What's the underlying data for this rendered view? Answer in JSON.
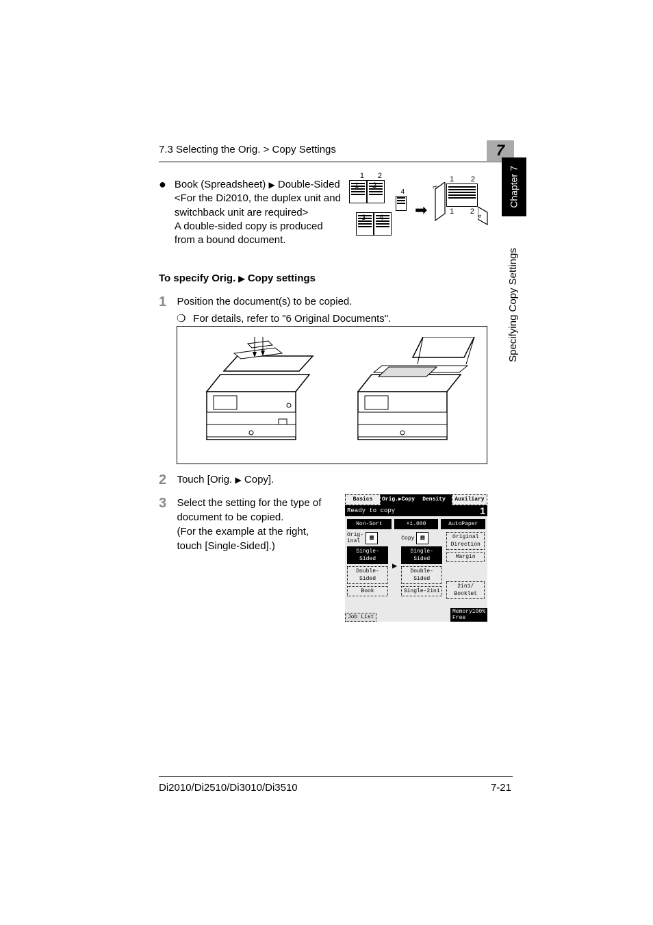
{
  "header": {
    "title": "7.3 Selecting the Orig. > Copy Settings"
  },
  "chapter": {
    "number": "7",
    "tab_label": "Chapter 7",
    "side_label": "Specifying Copy Settings"
  },
  "bullet": {
    "title_part1": "Book (Spreadsheet)",
    "title_part2": "Double-Sided",
    "note": "<For the Di2010, the duplex unit and switchback unit are required>",
    "desc": "A double-sided copy is produced from a bound document."
  },
  "diagram": {
    "src_pages": [
      "1",
      "2",
      "3",
      "4"
    ],
    "dst_pages": [
      "1",
      "2",
      "3",
      "4"
    ],
    "mid_small": "4"
  },
  "subheading": {
    "part1": "To specify Orig.",
    "part2": "Copy settings"
  },
  "steps": {
    "s1_num": "1",
    "s1_text": "Position the document(s) to be copied.",
    "s1_sub": "For details, refer to \"6 Original Documents\".",
    "s2_num": "2",
    "s2_text_a": "Touch [Orig.",
    "s2_text_b": "Copy].",
    "s3_num": "3",
    "s3_text": "Select the setting for the type of document to be copied.\n(For the example at the right, touch [Single-Sided].)"
  },
  "touchscreen": {
    "tabs": [
      "Basics",
      "Orig.▶Copy",
      "Density",
      "Auxiliary"
    ],
    "status_text": "Ready to copy",
    "counter": "1",
    "top_buttons": [
      "Non-Sort",
      "×1.000",
      "AutoPaper"
    ],
    "orig_label": "Orig-\ninal",
    "copy_label": "Copy",
    "right_buttons": [
      "Original\nDirection",
      "Margin"
    ],
    "orig_col": [
      "Single-\nSided",
      "Double-\nSided",
      "Book"
    ],
    "copy_col": [
      "Single-\nSided",
      "Double-\nSided",
      "Single-2in1"
    ],
    "booklet_label": "2in1/\nBooklet",
    "job_list": "Job List",
    "memory": "Memory100%\nFree"
  },
  "footer": {
    "left": "Di2010/Di2510/Di3010/Di3510",
    "right": "7-21"
  }
}
